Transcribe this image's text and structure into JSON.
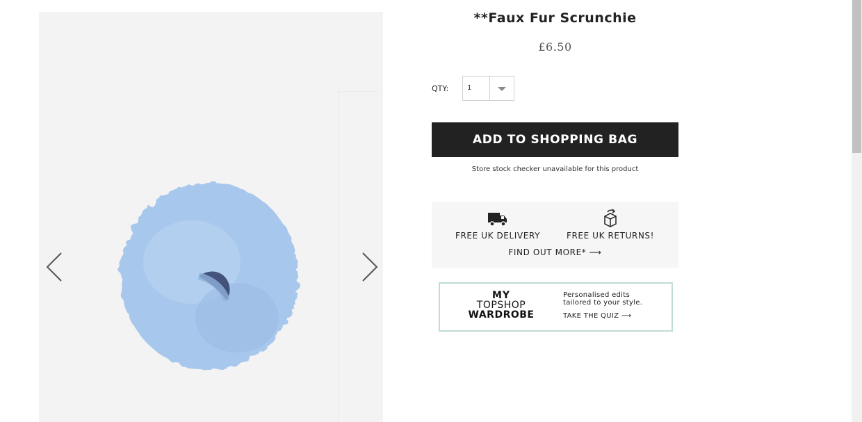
{
  "product": {
    "title": "**Faux Fur Scrunchie",
    "price": "£6.50",
    "image_alt": "blue faux fur scrunchie"
  },
  "gallery": {
    "prev_icon": "chevron-left-icon",
    "next_icon": "chevron-right-icon"
  },
  "quantity": {
    "label": "QTY:",
    "value": "1"
  },
  "actions": {
    "add_to_bag": "ADD TO SHOPPING BAG",
    "stock_note": "Store stock checker unavailable for this product"
  },
  "delivery": {
    "delivery_text": "FREE UK DELIVERY",
    "returns_text": "FREE UK RETURNS!",
    "find_out_more": "FIND OUT MORE* ⟶"
  },
  "wardrobe": {
    "logo_line1": "MY",
    "logo_line2": "TOPSHOP",
    "logo_line3": "WARDROBE",
    "line1": "Personalised edits",
    "line2": "tailored to your style.",
    "cta": "TAKE THE QUIZ ⟶"
  },
  "colors": {
    "button_bg": "#222222",
    "panel_bg": "#f6f6f6",
    "wardrobe_border": "#bfdcd6",
    "product_blue": "#a9c9ee"
  }
}
